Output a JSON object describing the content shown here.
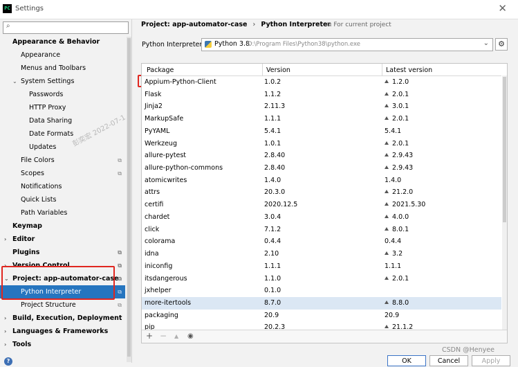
{
  "window": {
    "title": "Settings",
    "logo": "PC"
  },
  "sidebar": {
    "search_placeholder": "",
    "items": [
      {
        "label": "Appearance & Behavior",
        "level": 0,
        "bold": true,
        "arrow": "",
        "indicator": false
      },
      {
        "label": "Appearance",
        "level": 1,
        "bold": false,
        "arrow": "",
        "indicator": false
      },
      {
        "label": "Menus and Toolbars",
        "level": 1,
        "bold": false,
        "arrow": "",
        "indicator": false
      },
      {
        "label": "System Settings",
        "level": 1,
        "bold": false,
        "arrow": "⌄",
        "indicator": false
      },
      {
        "label": "Passwords",
        "level": 2,
        "bold": false,
        "arrow": "",
        "indicator": false
      },
      {
        "label": "HTTP Proxy",
        "level": 2,
        "bold": false,
        "arrow": "",
        "indicator": false
      },
      {
        "label": "Data Sharing",
        "level": 2,
        "bold": false,
        "arrow": "",
        "indicator": false
      },
      {
        "label": "Date Formats",
        "level": 2,
        "bold": false,
        "arrow": "",
        "indicator": false
      },
      {
        "label": "Updates",
        "level": 2,
        "bold": false,
        "arrow": "",
        "indicator": false
      },
      {
        "label": "File Colors",
        "level": 1,
        "bold": false,
        "arrow": "",
        "indicator": true
      },
      {
        "label": "Scopes",
        "level": 1,
        "bold": false,
        "arrow": "",
        "indicator": true
      },
      {
        "label": "Notifications",
        "level": 1,
        "bold": false,
        "arrow": "",
        "indicator": false
      },
      {
        "label": "Quick Lists",
        "level": 1,
        "bold": false,
        "arrow": "",
        "indicator": false
      },
      {
        "label": "Path Variables",
        "level": 1,
        "bold": false,
        "arrow": "",
        "indicator": false
      },
      {
        "label": "Keymap",
        "level": 0,
        "bold": true,
        "arrow": "",
        "indicator": false
      },
      {
        "label": "Editor",
        "level": 0,
        "bold": true,
        "arrow": "›",
        "indicator": false
      },
      {
        "label": "Plugins",
        "level": 0,
        "bold": true,
        "arrow": "",
        "indicator": true
      },
      {
        "label": "Version Control",
        "level": 0,
        "bold": true,
        "arrow": "›",
        "indicator": true
      },
      {
        "label": "Project: app-automator-case",
        "level": 0,
        "bold": true,
        "arrow": "⌄",
        "indicator": true
      },
      {
        "label": "Python Interpreter",
        "level": 1,
        "bold": false,
        "arrow": "",
        "indicator": true,
        "selected": true
      },
      {
        "label": "Project Structure",
        "level": 1,
        "bold": false,
        "arrow": "",
        "indicator": true
      },
      {
        "label": "Build, Execution, Deployment",
        "level": 0,
        "bold": true,
        "arrow": "›",
        "indicator": false
      },
      {
        "label": "Languages & Frameworks",
        "level": 0,
        "bold": true,
        "arrow": "›",
        "indicator": false
      },
      {
        "label": "Tools",
        "level": 0,
        "bold": true,
        "arrow": "›",
        "indicator": false
      }
    ],
    "watermark": "彭奕宏   2022-07-1"
  },
  "breadcrumb": {
    "project": "Project: app-automator-case",
    "separator": "›",
    "page": "Python Interpreter",
    "note": "For current project"
  },
  "interpreter": {
    "label": "Python Interpreter:",
    "name": "Python 3.8",
    "path": "D:\\Program Files\\Python38\\python.exe"
  },
  "table": {
    "headers": [
      "Package",
      "Version",
      "Latest version"
    ],
    "rows": [
      {
        "package": "Appium-Python-Client",
        "version": "1.0.2",
        "latest": "1.2.0",
        "upgrade": true
      },
      {
        "package": "Flask",
        "version": "1.1.2",
        "latest": "2.0.1",
        "upgrade": true
      },
      {
        "package": "Jinja2",
        "version": "2.11.3",
        "latest": "3.0.1",
        "upgrade": true
      },
      {
        "package": "MarkupSafe",
        "version": "1.1.1",
        "latest": "2.0.1",
        "upgrade": true
      },
      {
        "package": "PyYAML",
        "version": "5.4.1",
        "latest": "5.4.1",
        "upgrade": false
      },
      {
        "package": "Werkzeug",
        "version": "1.0.1",
        "latest": "2.0.1",
        "upgrade": true
      },
      {
        "package": "allure-pytest",
        "version": "2.8.40",
        "latest": "2.9.43",
        "upgrade": true
      },
      {
        "package": "allure-python-commons",
        "version": "2.8.40",
        "latest": "2.9.43",
        "upgrade": true
      },
      {
        "package": "atomicwrites",
        "version": "1.4.0",
        "latest": "1.4.0",
        "upgrade": false
      },
      {
        "package": "attrs",
        "version": "20.3.0",
        "latest": "21.2.0",
        "upgrade": true
      },
      {
        "package": "certifi",
        "version": "2020.12.5",
        "latest": "2021.5.30",
        "upgrade": true
      },
      {
        "package": "chardet",
        "version": "3.0.4",
        "latest": "4.0.0",
        "upgrade": true
      },
      {
        "package": "click",
        "version": "7.1.2",
        "latest": "8.0.1",
        "upgrade": true
      },
      {
        "package": "colorama",
        "version": "0.4.4",
        "latest": "0.4.4",
        "upgrade": false
      },
      {
        "package": "idna",
        "version": "2.10",
        "latest": "3.2",
        "upgrade": true
      },
      {
        "package": "iniconfig",
        "version": "1.1.1",
        "latest": "1.1.1",
        "upgrade": false
      },
      {
        "package": "itsdangerous",
        "version": "1.1.0",
        "latest": "2.0.1",
        "upgrade": true
      },
      {
        "package": "jxhelper",
        "version": "0.1.0",
        "latest": "",
        "upgrade": false
      },
      {
        "package": "more-itertools",
        "version": "8.7.0",
        "latest": "8.8.0",
        "upgrade": true,
        "highlighted": true
      },
      {
        "package": "packaging",
        "version": "20.9",
        "latest": "20.9",
        "upgrade": false
      },
      {
        "package": "pip",
        "version": "20.2.3",
        "latest": "21.1.2",
        "upgrade": true
      }
    ]
  },
  "toolbar": {
    "add": "+",
    "remove": "−",
    "upgrade": "▲",
    "show": "◉"
  },
  "buttons": {
    "ok": "OK",
    "cancel": "Cancel",
    "apply": "Apply"
  },
  "credit": "CSDN @Henyee",
  "colors": {
    "selection": "#2675bf",
    "highlight_row": "#dbe7f4",
    "annotation_red": "#e0261f"
  }
}
